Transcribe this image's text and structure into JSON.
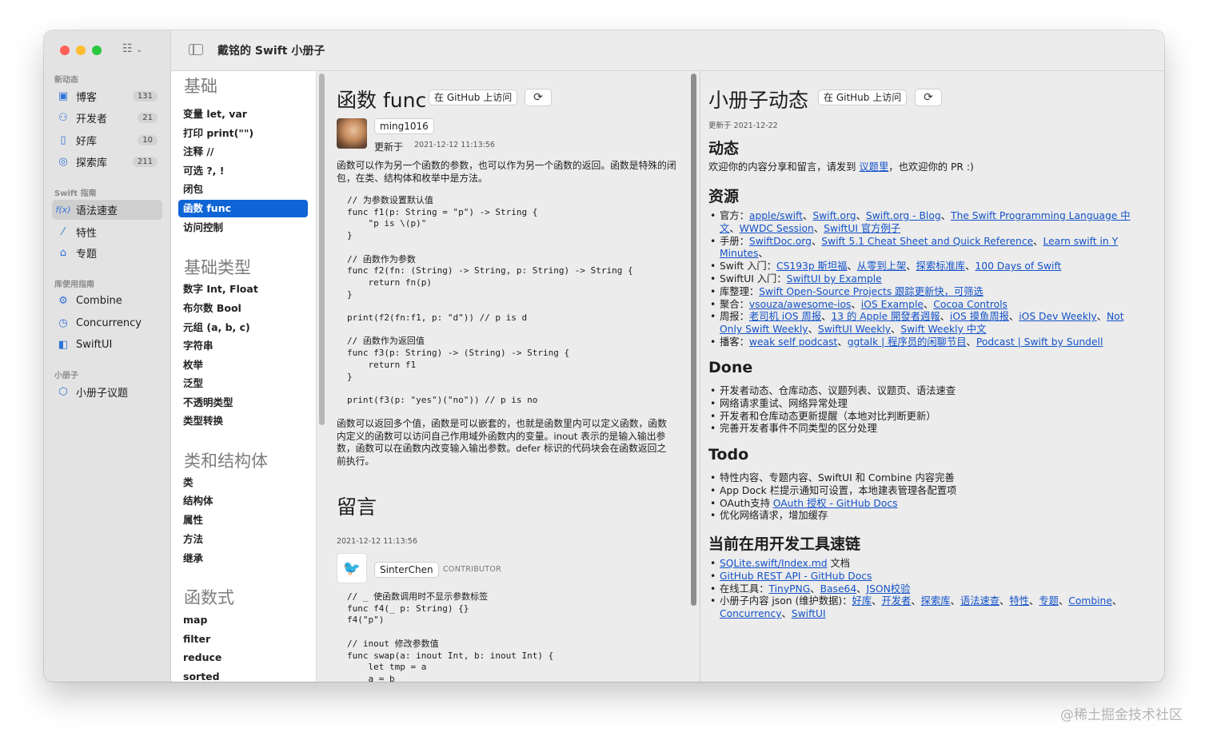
{
  "window": {
    "title": "戴铭的 Swift 小册子"
  },
  "sidebar": {
    "sections": [
      {
        "title": "新动态",
        "items": [
          {
            "label": "博客",
            "badge": "131",
            "icon": "blog-icon"
          },
          {
            "label": "开发者",
            "badge": "21",
            "icon": "developers-icon"
          },
          {
            "label": "好库",
            "badge": "10",
            "icon": "library-icon"
          },
          {
            "label": "探索库",
            "badge": "211",
            "icon": "explore-icon"
          }
        ]
      },
      {
        "title": "Swift 指南",
        "items": [
          {
            "label": "语法速查",
            "icon": "function-icon",
            "selected": true
          },
          {
            "label": "特性",
            "icon": "feature-icon"
          },
          {
            "label": "专题",
            "icon": "topic-icon"
          }
        ]
      },
      {
        "title": "库使用指南",
        "items": [
          {
            "label": "Combine",
            "icon": "combine-icon"
          },
          {
            "label": "Concurrency",
            "icon": "concurrency-icon"
          },
          {
            "label": "SwiftUI",
            "icon": "swiftui-icon"
          }
        ]
      },
      {
        "title": "小册子",
        "items": [
          {
            "label": "小册子议题",
            "icon": "issues-icon"
          }
        ]
      }
    ]
  },
  "list": {
    "groups": [
      {
        "heading": "基础",
        "items": [
          "变量 let, var",
          "打印 print(\"\")",
          "注释 //",
          "可选 ?, !",
          "闭包",
          "函数 func",
          "访问控制"
        ]
      },
      {
        "heading": "基础类型",
        "items": [
          "数字 Int, Float",
          "布尔数 Bool",
          "元组 (a, b, c)",
          "字符串",
          "枚举",
          "泛型",
          "不透明类型",
          "类型转换"
        ]
      },
      {
        "heading": "类和结构体",
        "items": [
          "类",
          "结构体",
          "属性",
          "方法",
          "继承"
        ]
      },
      {
        "heading": "函数式",
        "items": [
          "map",
          "filter",
          "reduce",
          "sorted"
        ]
      }
    ],
    "selected": "函数 func"
  },
  "detail": {
    "title": "函数 func",
    "github_button": "在 GitHub 上访问",
    "author": "ming1016",
    "updated_label": "更新于",
    "updated_time": "2021-12-12 11:13:56",
    "intro": "函数可以作为另一个函数的参数，也可以作为另一个函数的返回。函数是特殊的闭包，在类、结构体和枚举中是方法。",
    "code1": "// 为参数设置默认值\nfunc f1(p: String = \"p\") -> String {\n    \"p is \\(p)\"\n}\n\n// 函数作为参数\nfunc f2(fn: (String) -> String, p: String) -> String {\n    return fn(p)\n}\n\nprint(f2(fn:f1, p: \"d\")) // p is d\n\n// 函数作为返回值\nfunc f3(p: String) -> (String) -> String {\n    return f1\n}\n\nprint(f3(p: \"yes\")(\"no\")) // p is no",
    "outro": "函数可以返回多个值，函数是可以嵌套的，也就是函数里内可以定义函数，函数内定义的函数可以访问自己作用域外函数内的变量。inout 表示的是输入输出参数，函数可以在函数内改变输入输出参数。defer 标识的代码块会在函数返回之前执行。",
    "comments_title": "留言",
    "comment_time": "2021-12-12 11:13:56",
    "commenter": "SinterChen",
    "commenter_role": "CONTRIBUTOR",
    "code2": "// _ 使函数调用时不显示参数标签\nfunc f4(_ p: String) {}\nf4(\"p\")\n\n// inout 修改参数值\nfunc swap(a: inout Int, b: inout Int) {\n    let tmp = a\n    a = b"
  },
  "news": {
    "title": "小册子动态",
    "github_button": "在 GitHub 上访问",
    "updated": "更新于 2021-12-22",
    "h_dynamic": "动态",
    "dynamic_pre": "欢迎你的内容分享和留言，请发到 ",
    "dynamic_link": "议题里",
    "dynamic_post": "，也欢迎你的 PR :)",
    "h_resources": "资源",
    "res_official_label": "官方：",
    "res_official_links": [
      "apple/swift",
      "Swift.org",
      "Swift.org - Blog",
      "The Swift Programming Language 中文",
      "WWDC Session",
      "SwiftUI 官方例子"
    ],
    "res_manual_label": "手册：",
    "res_manual_links": [
      "SwiftDoc.org",
      "Swift 5.1 Cheat Sheet and Quick Reference",
      "Learn swift in Y Minutes"
    ],
    "res_intro_label": "Swift 入门：",
    "res_intro_links": [
      "CS193p 斯坦福",
      "从零到上架",
      "探索标准库",
      "100 Days of Swift"
    ],
    "res_ui_label": "SwiftUI 入门：",
    "res_ui_links": [
      "SwiftUI by Example"
    ],
    "res_lib_label": "库整理：",
    "res_lib_links": [
      "Swift Open-Source Projects 跟踪更新快，可筛选"
    ],
    "res_agg_label": "聚合：",
    "res_agg_links": [
      "vsouza/awesome-ios",
      "iOS Example",
      "Cocoa Controls"
    ],
    "res_weekly_label": "周报：",
    "res_weekly_links": [
      "老司机 iOS 周报",
      "13 的 Apple 開發者週報",
      "iOS 摸鱼周报",
      "iOS Dev Weekly",
      "Not Only Swift Weekly",
      "SwiftUI Weekly",
      "Swift Weekly 中文"
    ],
    "res_pod_label": "播客：",
    "res_pod_links": [
      "weak self podcast",
      "ggtalk | 程序员的闲聊节目",
      "Podcast | Swift by Sundell"
    ],
    "h_done": "Done",
    "done": [
      "开发者动态、仓库动态、议题列表、议题页、语法速查",
      "网络请求重试、网络异常处理",
      "开发者和仓库动态更新提醒（本地对比判断更新）",
      "完善开发者事件不同类型的区分处理"
    ],
    "h_todo": "Todo",
    "todo_1": "特性内容、专题内容、SwiftUI 和 Combine 内容完善",
    "todo_2": "App Dock 栏提示通知可设置，本地建表管理各配置项",
    "todo_3_pre": "OAuth支持 ",
    "todo_3_link": "OAuth 授权 - GitHub Docs",
    "todo_4": "优化网络请求，增加缓存",
    "h_tools": "当前在用开发工具速链",
    "tool_1_link": "SQLite.swift/Index.md",
    "tool_1_post": " 文档",
    "tool_2_link": "GitHub REST API - GitHub Docs",
    "tool_3_pre": "在线工具：",
    "tool_3_links": [
      "TinyPNG",
      "Base64",
      "JSON校验"
    ],
    "tool_4_pre": "小册子内容 json (维护数据)：",
    "tool_4_links": [
      "好库",
      "开发者",
      "探索库",
      "语法速查",
      "特性",
      "专题",
      "Combine",
      "Concurrency",
      "SwiftUI"
    ]
  },
  "watermark": "@稀土掘金技术社区"
}
